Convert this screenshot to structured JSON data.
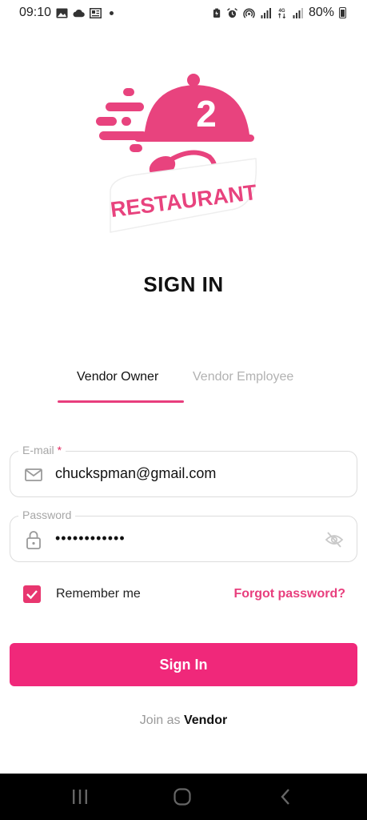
{
  "status_bar": {
    "time": "09:10",
    "battery": "80%",
    "left_icons": [
      "image-icon",
      "cloud-icon",
      "news-icon",
      "dot-icon"
    ],
    "right_icons": [
      "battery-saver-icon",
      "alarm-icon",
      "hotspot-icon",
      "signal-icon",
      "4g-icon",
      "signal-icon"
    ]
  },
  "logo": {
    "number": "2",
    "text": "RESTAURANT",
    "brand_color": "#e8437e"
  },
  "page": {
    "title": "SIGN IN"
  },
  "tabs": {
    "active": "Vendor Owner",
    "inactive": "Vendor Employee"
  },
  "email_field": {
    "label": "E-mail",
    "required_mark": "*",
    "value": "chuckspman@gmail.com",
    "icon": "mail-icon"
  },
  "password_field": {
    "label": "Password",
    "value": "••••••••••••",
    "icon": "lock-icon",
    "toggle_icon": "eye-off-icon"
  },
  "remember": {
    "label": "Remember me",
    "checked": true
  },
  "forgot": {
    "label": "Forgot password?"
  },
  "signin_button": {
    "label": "Sign In"
  },
  "join": {
    "prefix": "Join as",
    "link": "Vendor"
  },
  "nav_bar": {
    "icons": [
      "recent-apps-icon",
      "home-icon",
      "back-icon"
    ]
  },
  "colors": {
    "accent": "#e83e7d",
    "button": "#f0287a"
  }
}
